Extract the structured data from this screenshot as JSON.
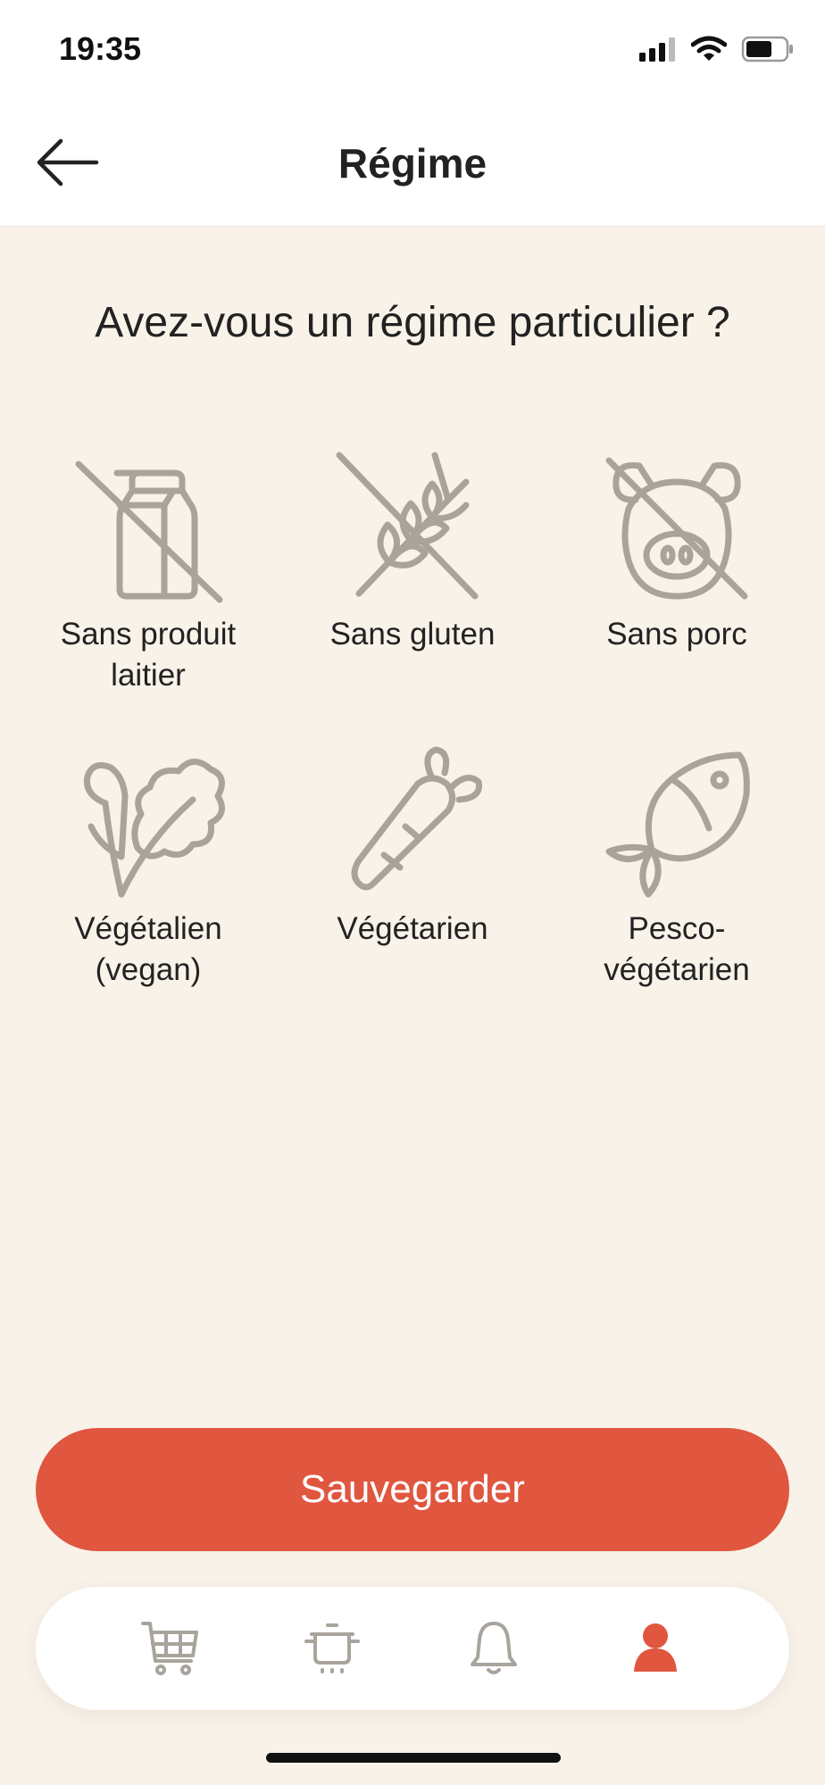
{
  "status_bar": {
    "time": "19:35"
  },
  "header": {
    "title": "Régime"
  },
  "question": "Avez-vous un régime particulier ?",
  "options": [
    {
      "label_line1": "Sans produit",
      "label_line2": "laitier",
      "icon": "no-milk-icon"
    },
    {
      "label_line1": "Sans gluten",
      "label_line2": "",
      "icon": "no-wheat-icon"
    },
    {
      "label_line1": "Sans porc",
      "label_line2": "",
      "icon": "no-pork-icon"
    },
    {
      "label_line1": "Végétalien",
      "label_line2": "(vegan)",
      "icon": "leaf-icon"
    },
    {
      "label_line1": "Végétarien",
      "label_line2": "",
      "icon": "carrot-icon"
    },
    {
      "label_line1": "Pesco-",
      "label_line2": "végétarien",
      "icon": "fish-icon"
    }
  ],
  "save_button": {
    "label": "Sauvegarder"
  },
  "tabs": [
    {
      "name": "cart",
      "icon": "cart-icon",
      "active": false
    },
    {
      "name": "recipes",
      "icon": "cooking-pot-icon",
      "active": false
    },
    {
      "name": "notifications",
      "icon": "bell-icon",
      "active": false
    },
    {
      "name": "profile",
      "icon": "user-icon",
      "active": true
    }
  ],
  "colors": {
    "background": "#f8f2e8",
    "accent": "#e0563f",
    "icon_gray": "#a8a49c",
    "text": "#222222"
  }
}
